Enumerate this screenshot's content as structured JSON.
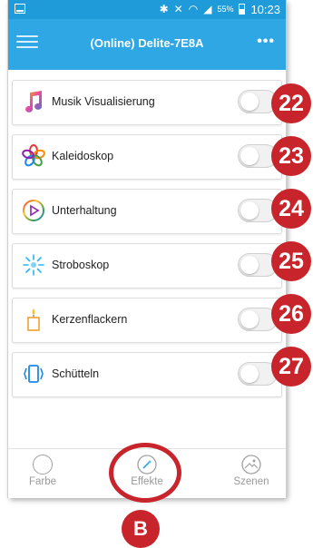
{
  "status_bar": {
    "battery_percent": "55%",
    "time": "10:23"
  },
  "app_bar": {
    "title": "(Online) Delite-7E8A"
  },
  "effects": [
    {
      "label": "Musik Visualisierung",
      "icon": "music-note-icon",
      "enabled": false,
      "callout": "22"
    },
    {
      "label": "Kaleidoskop",
      "icon": "kaleidoscope-flower-icon",
      "enabled": false,
      "callout": "23"
    },
    {
      "label": "Unterhaltung",
      "icon": "play-circle-icon",
      "enabled": false,
      "callout": "24"
    },
    {
      "label": "Stroboskop",
      "icon": "strobe-burst-icon",
      "enabled": false,
      "callout": "25"
    },
    {
      "label": "Kerzenflackern",
      "icon": "candle-icon",
      "enabled": false,
      "callout": "26"
    },
    {
      "label": "Schütteln",
      "icon": "shake-phone-icon",
      "enabled": false,
      "callout": "27"
    }
  ],
  "bottom_nav": {
    "items": [
      {
        "label": "Farbe",
        "icon": "color-circle-icon"
      },
      {
        "label": "Effekte",
        "icon": "magic-wand-icon",
        "active": true
      },
      {
        "label": "Szenen",
        "icon": "scene-landscape-icon"
      }
    ]
  },
  "callout_b": "B",
  "colors": {
    "accent": "#2ea7e4",
    "callout": "#c8242b"
  }
}
